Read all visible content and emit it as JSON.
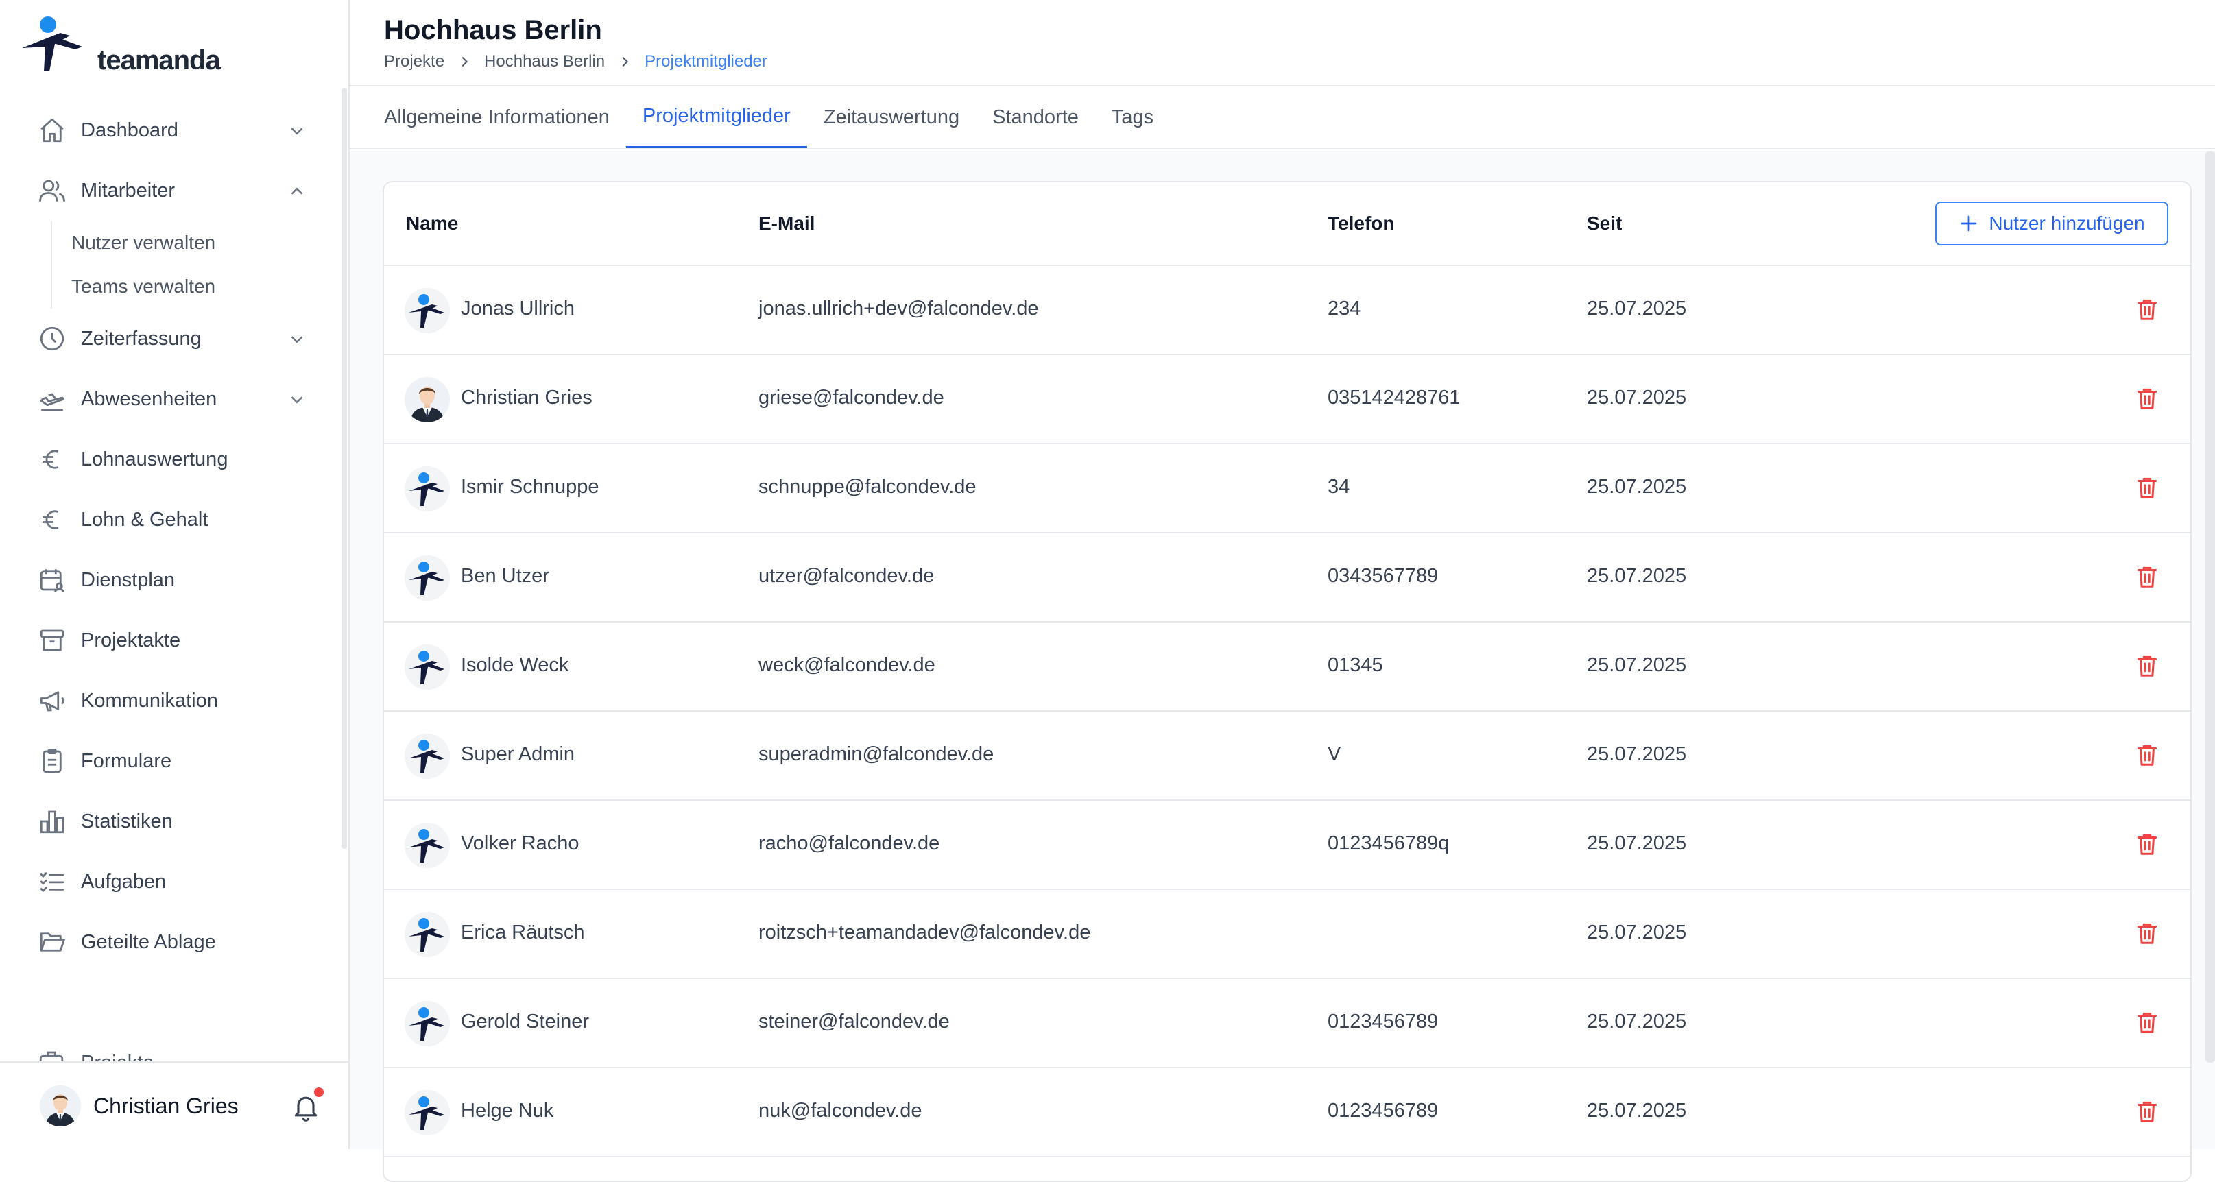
{
  "app": {
    "brand": "teamanda"
  },
  "sidebar": {
    "items": [
      {
        "label": "Dashboard",
        "icon": "home-icon",
        "chevron": "down"
      },
      {
        "label": "Mitarbeiter",
        "icon": "users-icon",
        "chevron": "up",
        "children": [
          {
            "label": "Nutzer verwalten"
          },
          {
            "label": "Teams verwalten"
          }
        ]
      },
      {
        "label": "Zeiterfassung",
        "icon": "clock-icon",
        "chevron": "down"
      },
      {
        "label": "Abwesenheiten",
        "icon": "plane-icon",
        "chevron": "down"
      },
      {
        "label": "Lohnauswertung",
        "icon": "euro-icon"
      },
      {
        "label": "Lohn & Gehalt",
        "icon": "euro-icon"
      },
      {
        "label": "Dienstplan",
        "icon": "calendar-user-icon"
      },
      {
        "label": "Projektakte",
        "icon": "archive-icon"
      },
      {
        "label": "Kommunikation",
        "icon": "megaphone-icon"
      },
      {
        "label": "Formulare",
        "icon": "clipboard-icon"
      },
      {
        "label": "Statistiken",
        "icon": "bar-chart-icon"
      },
      {
        "label": "Aufgaben",
        "icon": "checklist-icon"
      },
      {
        "label": "Geteilte Ablage",
        "icon": "folder-open-icon"
      }
    ],
    "cut_item": {
      "label": "Projekte",
      "icon": "briefcase-icon"
    },
    "user": {
      "name": "Christian Gries",
      "notification_dot_color": "#ef4444"
    }
  },
  "header": {
    "title": "Hochhaus Berlin",
    "breadcrumb": [
      "Projekte",
      "Hochhaus Berlin",
      "Projektmitglieder"
    ]
  },
  "tabs": [
    {
      "label": "Allgemeine Informationen",
      "active": false
    },
    {
      "label": "Projektmitglieder",
      "active": true
    },
    {
      "label": "Zeitauswertung",
      "active": false
    },
    {
      "label": "Standorte",
      "active": false
    },
    {
      "label": "Tags",
      "active": false
    }
  ],
  "table": {
    "headers": {
      "name": "Name",
      "email": "E-Mail",
      "phone": "Telefon",
      "since": "Seit"
    },
    "add_button": "Nutzer hinzufügen",
    "rows": [
      {
        "name": "Jonas Ullrich",
        "email": "jonas.ullrich+dev@falcondev.de",
        "phone": "234",
        "since": "25.07.2025",
        "avatar": "logo"
      },
      {
        "name": "Christian Gries",
        "email": "griese@falcondev.de",
        "phone": "035142428761",
        "since": "25.07.2025",
        "avatar": "person"
      },
      {
        "name": "Ismir Schnuppe",
        "email": "schnuppe@falcondev.de",
        "phone": "34",
        "since": "25.07.2025",
        "avatar": "logo"
      },
      {
        "name": "Ben Utzer",
        "email": "utzer@falcondev.de",
        "phone": "0343567789",
        "since": "25.07.2025",
        "avatar": "logo"
      },
      {
        "name": "Isolde Weck",
        "email": "weck@falcondev.de",
        "phone": "01345",
        "since": "25.07.2025",
        "avatar": "logo"
      },
      {
        "name": "Super Admin",
        "email": "superadmin@falcondev.de",
        "phone": "V",
        "since": "25.07.2025",
        "avatar": "logo"
      },
      {
        "name": "Volker Racho",
        "email": "racho@falcondev.de",
        "phone": "0123456789q",
        "since": "25.07.2025",
        "avatar": "logo"
      },
      {
        "name": "Erica Räutsch",
        "email": "roitzsch+teamandadev@falcondev.de",
        "phone": "",
        "since": "25.07.2025",
        "avatar": "logo"
      },
      {
        "name": "Gerold Steiner",
        "email": "steiner@falcondev.de",
        "phone": "0123456789",
        "since": "25.07.2025",
        "avatar": "logo"
      },
      {
        "name": "Helge Nuk",
        "email": "nuk@falcondev.de",
        "phone": "0123456789",
        "since": "25.07.2025",
        "avatar": "logo"
      }
    ]
  },
  "colors": {
    "accent": "#2563eb",
    "danger": "#ef4444",
    "brand_blue": "#1d8cf0",
    "brand_dark": "#141a3a"
  }
}
